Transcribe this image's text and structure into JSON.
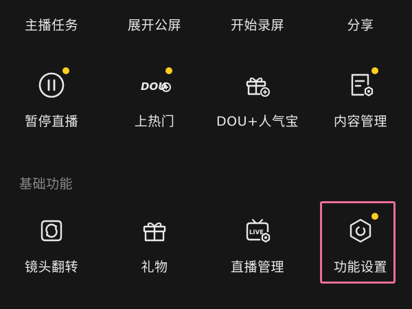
{
  "top_row": [
    {
      "label": "主播任务"
    },
    {
      "label": "展开公屏"
    },
    {
      "label": "开始录屏"
    },
    {
      "label": "分享"
    }
  ],
  "live_tools": [
    {
      "label": "暂停直播",
      "icon": "pause-icon",
      "badge": true
    },
    {
      "label": "上热门",
      "icon": "dou-plus-icon",
      "icon_text": "DOU",
      "badge": true
    },
    {
      "label": "DOU+人气宝",
      "icon": "gift-box-icon",
      "badge": false
    },
    {
      "label": "内容管理",
      "icon": "content-settings-icon",
      "badge": true
    }
  ],
  "basic_section": {
    "title": "基础功能",
    "items": [
      {
        "label": "镜头翻转",
        "icon": "camera-flip-icon",
        "badge": false
      },
      {
        "label": "礼物",
        "icon": "gift-icon",
        "badge": false
      },
      {
        "label": "直播管理",
        "icon": "live-tv-icon",
        "icon_text": "LIVE",
        "badge": false
      },
      {
        "label": "功能设置",
        "icon": "hexagon-settings-icon",
        "badge": true
      }
    ]
  },
  "colors": {
    "background": "#161616",
    "badge": "#ffce1f",
    "highlight": "#ef6e98",
    "section_title": "#8a8a8a"
  }
}
